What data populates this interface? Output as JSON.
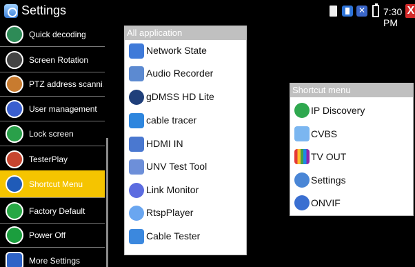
{
  "statusbar": {
    "title": "Settings",
    "time": "7:30 PM",
    "close_label": "X"
  },
  "sidebar": {
    "items": [
      {
        "label": "Quick decoding",
        "icon": "quick-decoding-icon"
      },
      {
        "label": "Screen Rotation",
        "icon": "screen-rotation-icon"
      },
      {
        "label": "PTZ address scanni...",
        "icon": "ptz-icon"
      },
      {
        "label": "User management",
        "icon": "user-icon"
      },
      {
        "label": "Lock screen",
        "icon": "lock-icon"
      },
      {
        "label": "TesterPlay",
        "icon": "tester-play-icon"
      },
      {
        "label": "Shortcut Menu",
        "icon": "shortcut-icon",
        "active": true
      },
      {
        "label": "Factory Default",
        "icon": "factory-default-icon"
      },
      {
        "label": "Power Off",
        "icon": "power-icon"
      },
      {
        "label": "More Settings",
        "icon": "more-settings-icon"
      }
    ]
  },
  "all_application": {
    "header": "All application",
    "items": [
      {
        "label": "Network State",
        "icon": "4g-icon"
      },
      {
        "label": "Audio Recorder",
        "icon": "audio-recorder-icon"
      },
      {
        "label": "gDMSS HD Lite",
        "icon": "gdmss-icon"
      },
      {
        "label": "cable tracer",
        "icon": "cable-tracer-icon"
      },
      {
        "label": "HDMI IN",
        "icon": "hdmi-icon"
      },
      {
        "label": "UNV Test Tool",
        "icon": "unv-icon"
      },
      {
        "label": "Link Monitor",
        "icon": "link-monitor-icon"
      },
      {
        "label": "RtspPlayer",
        "icon": "rtsp-player-icon"
      },
      {
        "label": "Cable Tester",
        "icon": "cable-tester-icon"
      }
    ]
  },
  "shortcut_menu": {
    "header": "Shortcut menu",
    "items": [
      {
        "label": "IP Discovery",
        "icon": "ip-discovery-icon"
      },
      {
        "label": "CVBS",
        "icon": "cvbs-icon"
      },
      {
        "label": "TV OUT",
        "icon": "tv-out-icon"
      },
      {
        "label": "Settings",
        "icon": "settings-icon"
      },
      {
        "label": "ONVIF",
        "icon": "onvif-icon"
      }
    ]
  },
  "colors": {
    "active_item": "#f5c400",
    "panel_header": "#c0c0c0",
    "close_button": "#d42a2a"
  }
}
